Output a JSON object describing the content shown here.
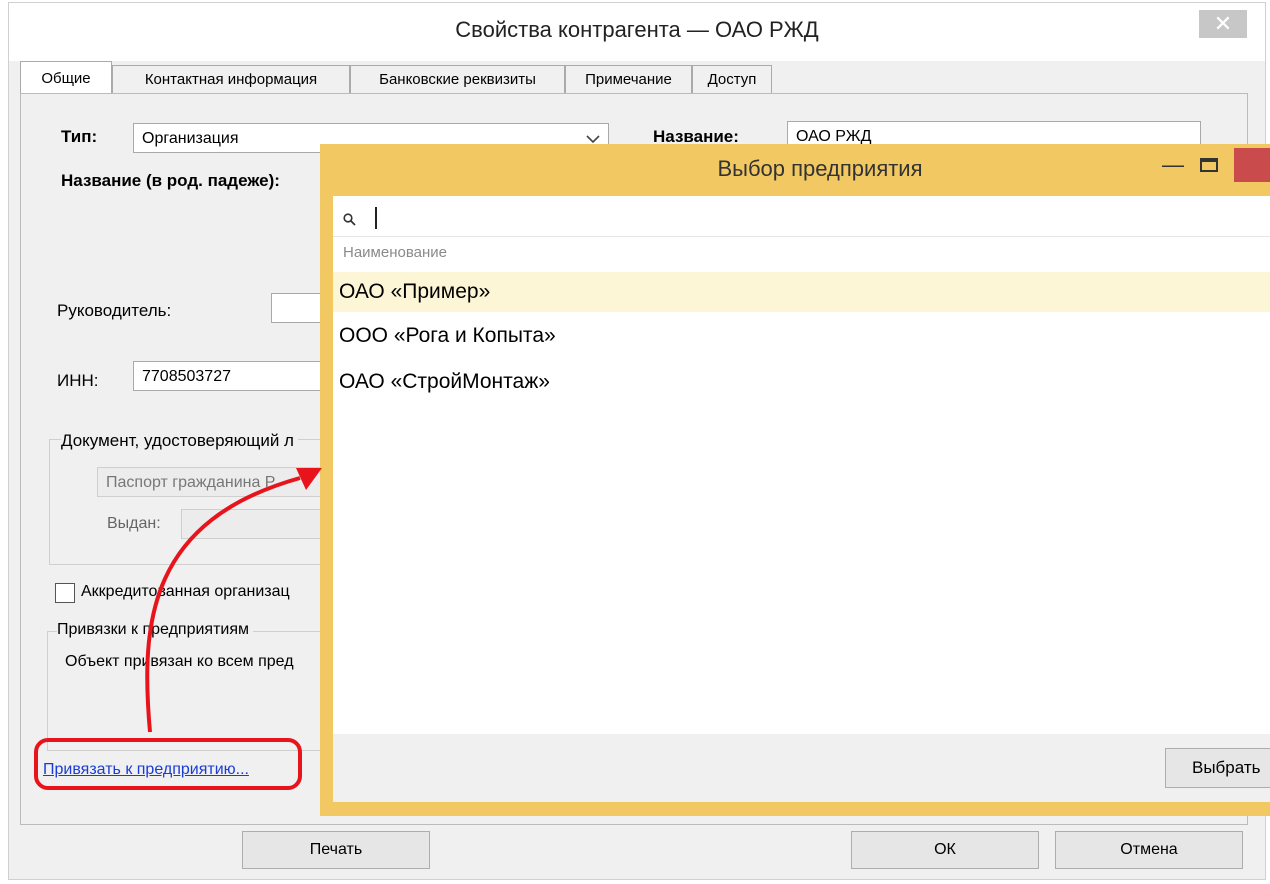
{
  "window": {
    "title": "Свойства контрагента — ОАО РЖД",
    "close_glyph": "✕"
  },
  "tabs": [
    {
      "label": "Общие",
      "active": true
    },
    {
      "label": "Контактная информация"
    },
    {
      "label": "Банковские реквизиты"
    },
    {
      "label": "Примечание"
    },
    {
      "label": "Доступ"
    }
  ],
  "form": {
    "type_label": "Тип:",
    "type_value": "Организация",
    "name_label": "Название:",
    "name_value": "ОАО РЖД",
    "genitive_label": "Название (в род. падеже):",
    "head_label": "Руководитель:",
    "head_value": "",
    "inn_label": "ИНН:",
    "inn_value": "7708503727",
    "id_doc_group": "Документ, удостоверяющий л",
    "id_doc_type": "Паспорт гражданина Р",
    "issued_label": "Выдан:",
    "issued_value": "",
    "accredited_label": "Аккредитованная организац",
    "accredited_checked": false,
    "bindings_group": "Привязки к предприятиям",
    "bindings_text": "Объект привязан ко всем пред",
    "bind_link": "Привязать к предприятию..."
  },
  "buttons": {
    "print": "Печать",
    "ok": "ОК",
    "cancel": "Отмена"
  },
  "dialog": {
    "title": "Выбор предприятия",
    "search_value": "",
    "column_header": "Наименование",
    "items": [
      {
        "name": "ОАО «Пример»",
        "selected": true
      },
      {
        "name": "ООО «Рога и Копыта»",
        "selected": false
      },
      {
        "name": "ОАО «СтройМонтаж»",
        "selected": false
      }
    ],
    "select_button": "Выбрать"
  },
  "colors": {
    "dialog_frame": "#f2c863",
    "selected_row": "#fdf6d6",
    "annotation": "#e8141b",
    "link": "#1a3cd6"
  },
  "icons": [
    "search-icon",
    "dropdown-chevron-icon",
    "minimize-icon",
    "maximize-icon",
    "close-icon"
  ]
}
